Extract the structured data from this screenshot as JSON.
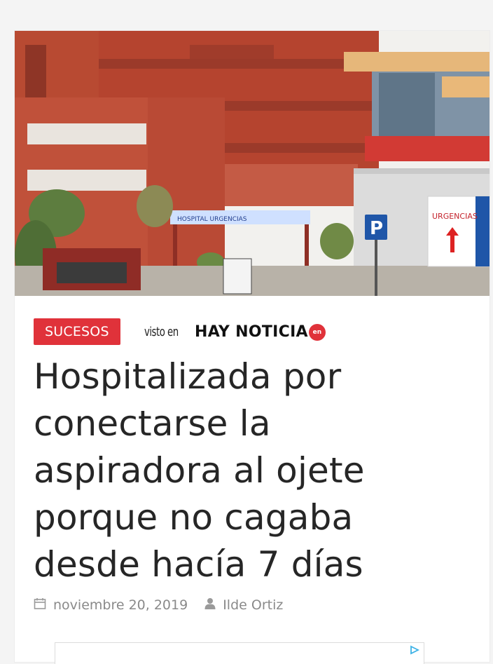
{
  "article": {
    "category": "SUCESOS",
    "source_prefix": "visto en",
    "source_name": "HAY NOTICIA",
    "source_badge": "en",
    "title": "Hospitalizada por conectarse la aspiradora al ojete porque no cagaba desde hacía 7 días",
    "date": "noviembre 20, 2019",
    "author": "Ilde Ortiz"
  },
  "photo_signs": {
    "hospital_sign": "HOSPITAL URGENCIAS",
    "urgencias_sign": "URGENCIAS",
    "parking_sign": "P"
  },
  "colors": {
    "accent": "#e0323a",
    "title": "#262626",
    "meta": "#8a8a8a"
  },
  "icons": {
    "date": "calendar-icon",
    "author": "user-icon",
    "ad": "adchoices-icon"
  }
}
